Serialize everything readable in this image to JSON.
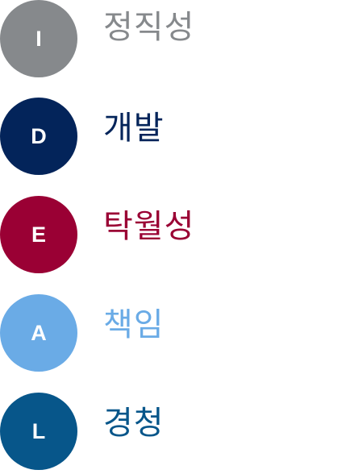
{
  "items": [
    {
      "letter": "I",
      "word": "정직성",
      "color": "#86898c"
    },
    {
      "letter": "D",
      "word": "개발",
      "color": "#03245a"
    },
    {
      "letter": "E",
      "word": "탁월성",
      "color": "#9a0034"
    },
    {
      "letter": "A",
      "word": "책임",
      "color": "#6aabe6"
    },
    {
      "letter": "L",
      "word": "경청",
      "color": "#07568a"
    }
  ]
}
